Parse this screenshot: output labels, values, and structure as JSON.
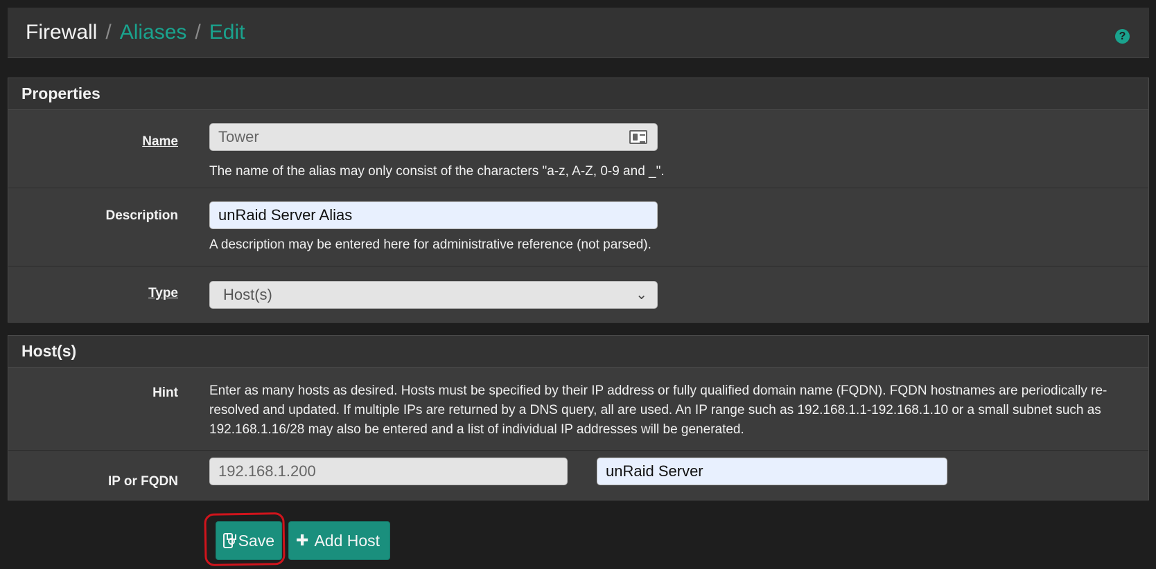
{
  "breadcrumb": {
    "root": "Firewall",
    "level1": "Aliases",
    "level2": "Edit",
    "separator": "/"
  },
  "help_icon": "?",
  "properties": {
    "heading": "Properties",
    "name": {
      "label": "Name",
      "value": "Tower",
      "help": "The name of the alias may only consist of the characters \"a-z, A-Z, 0-9 and _\"."
    },
    "description": {
      "label": "Description",
      "value": "unRaid Server Alias",
      "help": "A description may be entered here for administrative reference (not parsed)."
    },
    "type": {
      "label": "Type",
      "selected": "Host(s)"
    }
  },
  "hosts": {
    "heading": "Host(s)",
    "hint": {
      "label": "Hint",
      "text": "Enter as many hosts as desired. Hosts must be specified by their IP address or fully qualified domain name (FQDN). FQDN hostnames are periodically re-resolved and updated. If multiple IPs are returned by a DNS query, all are used. An IP range such as 192.168.1.1-192.168.1.10 or a small subnet such as 192.168.1.16/28 may also be entered and a list of individual IP addresses will be generated."
    },
    "entry": {
      "label": "IP or FQDN",
      "address": "192.168.1.200",
      "description": "unRaid Server"
    }
  },
  "buttons": {
    "save": "Save",
    "add_host": "Add Host"
  },
  "colors": {
    "accent": "#1aa38e",
    "button": "#1a8f7d",
    "highlight": "#d0141c"
  }
}
